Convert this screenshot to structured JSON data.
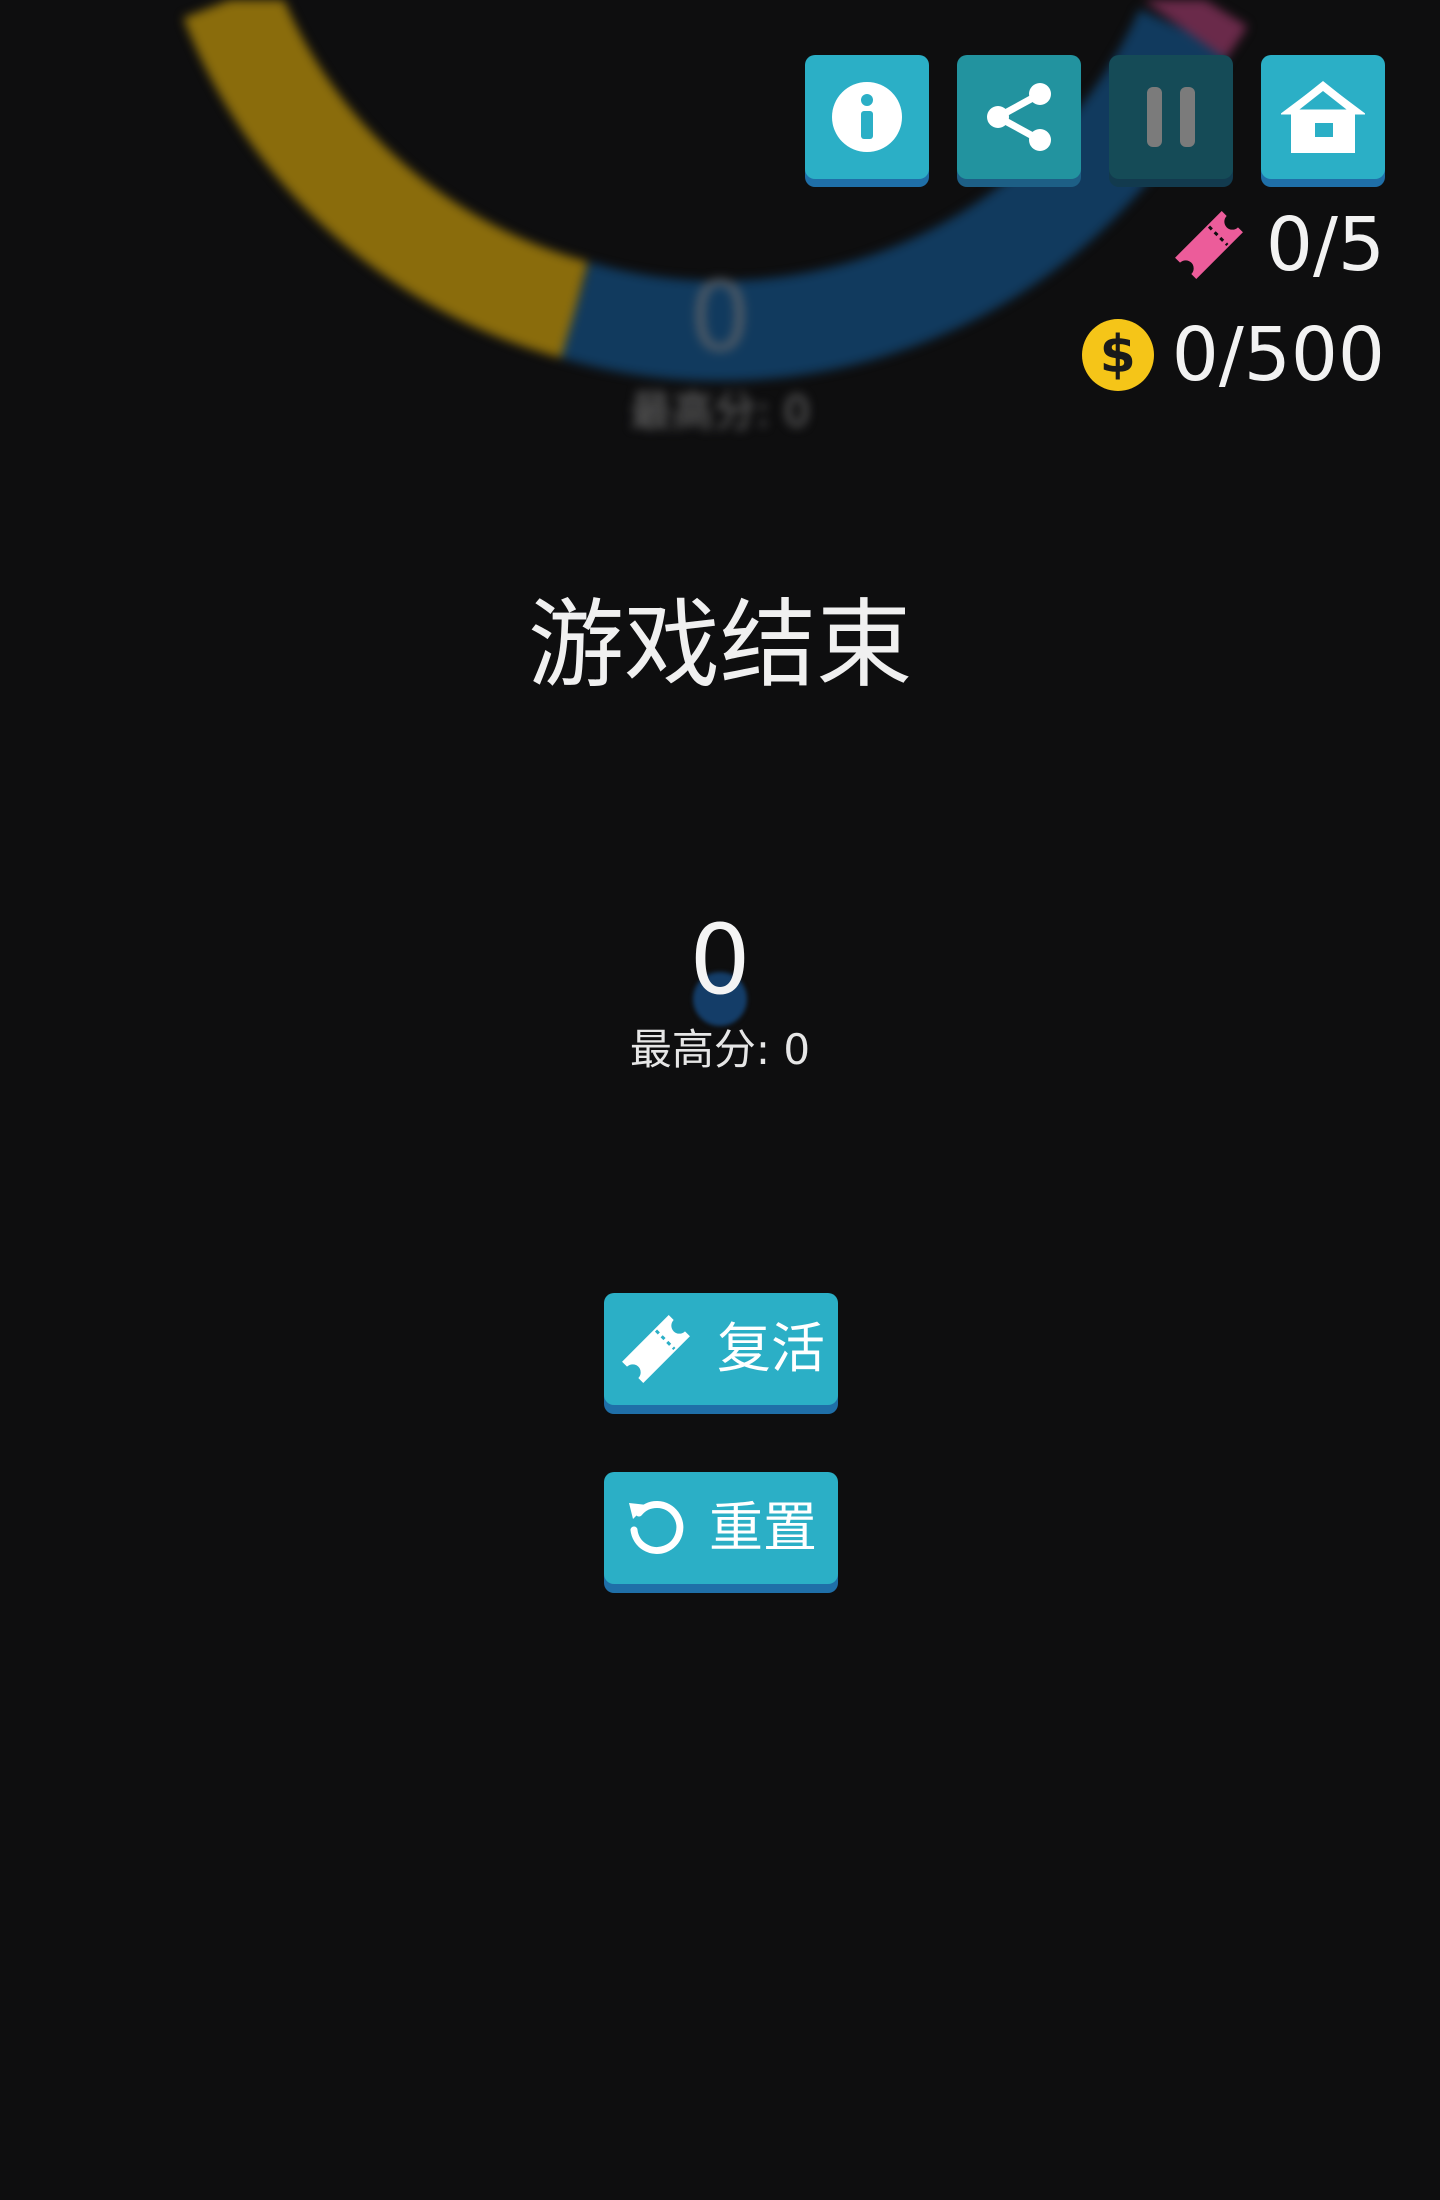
{
  "background": {
    "score": "0",
    "best_score": "最高分:  0",
    "ring_colors": [
      "#8a6c0c",
      "#113a5e",
      "#6a2a4a"
    ]
  },
  "toolbar": {
    "info_icon": "info-icon",
    "share_icon": "share-icon",
    "pause_icon": "pause-icon",
    "home_icon": "home-icon"
  },
  "resources": {
    "tickets": "0/5",
    "tickets_icon": "ticket-icon",
    "coins": "0/500",
    "coin_symbol": "$"
  },
  "game_over": {
    "title": "游戏结束",
    "score": "0",
    "best_score": "最高分:  0",
    "revive_label": "复活",
    "reset_label": "重置"
  },
  "colors": {
    "background": "#0e0e0f",
    "button": "#2bafc6",
    "button_shadow": "#1f6fa8",
    "ticket": "#ec5c9a",
    "coin": "#f5c518"
  }
}
